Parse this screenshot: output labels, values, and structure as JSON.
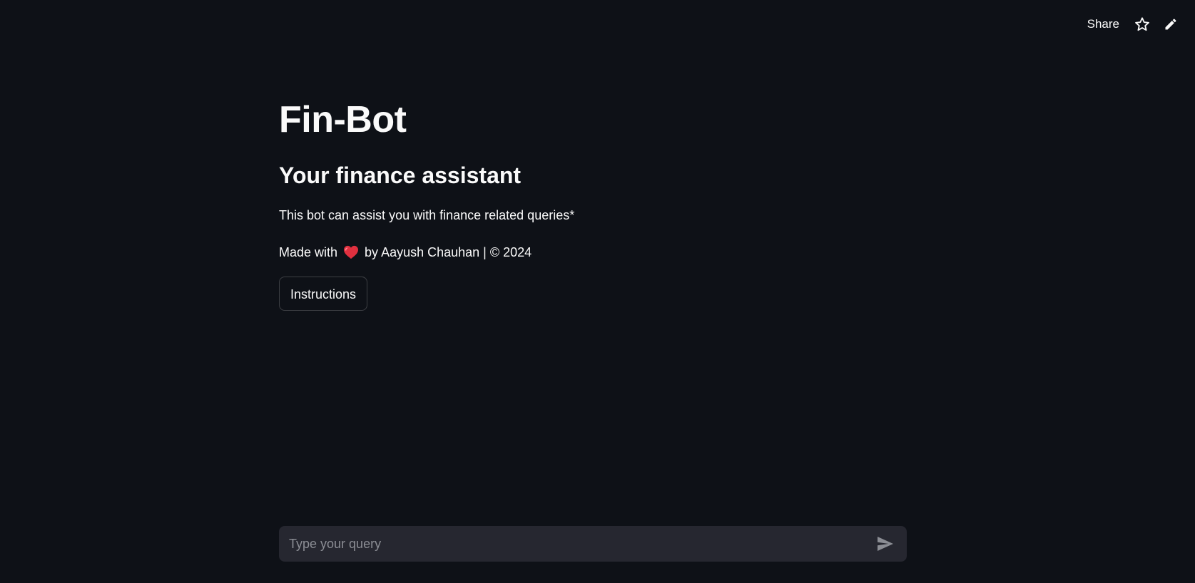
{
  "toolbar": {
    "share_label": "Share",
    "star_icon": "star-icon",
    "edit_icon": "pencil-icon"
  },
  "main": {
    "title": "Fin-Bot",
    "subtitle": "Your finance assistant",
    "description": "This bot can assist you with finance related queries*",
    "credit_prefix": "Made with",
    "credit_icon": "heart-icon",
    "credit_suffix": "by Aayush Chauhan | © 2024",
    "instructions_button": "Instructions"
  },
  "chat": {
    "placeholder": "Type your query",
    "value": "",
    "send_icon": "send-icon"
  },
  "colors": {
    "background": "#0e1117",
    "text": "#fafafa",
    "input_background": "#262730",
    "heart": "#e0303f"
  }
}
